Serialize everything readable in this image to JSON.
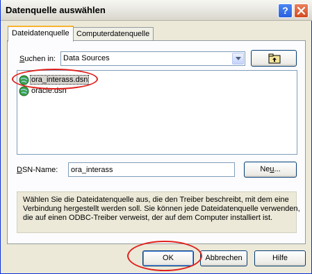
{
  "window": {
    "title": "Datenquelle auswählen"
  },
  "tabs": [
    {
      "label": "Dateidatenquelle",
      "active": true
    },
    {
      "label": "Computerdatenquelle",
      "active": false
    }
  ],
  "lookin": {
    "label_prefix": "S",
    "label_rest": "uchen in:",
    "value": "Data Sources"
  },
  "files": [
    {
      "name": "ora_interass.dsn",
      "icon": "dsn-file-icon",
      "selected": true
    },
    {
      "name": "oracle.dsn",
      "icon": "dsn-file-icon",
      "selected": false
    }
  ],
  "dsn": {
    "label_prefix": "D",
    "label_rest": "SN-Name:",
    "value": "ora_interass"
  },
  "new_button": {
    "label_prefix": "Ne",
    "label_ul": "u",
    "label_rest": "..."
  },
  "info": {
    "lines": [
      "Wählen Sie die Dateidatenquelle aus, die den Treiber beschreibt, mit dem eine",
      "Verbindung hergestellt werden soll. Sie können jede Dateidatenquelle verwenden,",
      "die auf einen ODBC-Treiber verweist, der auf dem Computer installiert ist."
    ]
  },
  "buttons": {
    "ok": "OK",
    "cancel": "Abbrechen",
    "help": "Hilfe"
  },
  "colors": {
    "annotation": "#E0201C",
    "title_blue": "#0831D9"
  }
}
